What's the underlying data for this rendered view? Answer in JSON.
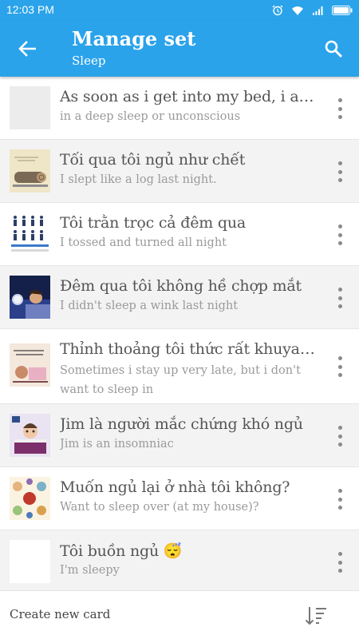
{
  "status_bar": {
    "time": "12:03 PM",
    "icons": [
      "alarm-icon",
      "wifi-icon",
      "signal-icon",
      "battery-icon"
    ]
  },
  "header": {
    "title": "Manage set",
    "subtitle": "Sleep",
    "back_icon": "arrow-back-icon",
    "search_icon": "search-icon"
  },
  "cards": [
    {
      "term": "As soon as i get into my bed, i am…",
      "definition": "in a deep sleep or unconscious",
      "image": "none"
    },
    {
      "term": "Tối qua tôi ngủ như chết",
      "definition": "I slept like a log last night.",
      "image": "sleeping-like-a-log"
    },
    {
      "term": "Tôi trằn trọc cả đêm qua",
      "definition": "I tossed and turned all night",
      "image": "sleep-positions"
    },
    {
      "term": "Đêm qua tôi không hề chợp mắt",
      "definition": "I didn't sleep a wink last night",
      "image": "awake-in-bed"
    },
    {
      "term": "Thỉnh thoảng tôi thức rất khuya n…",
      "definition": "Sometimes i stay up very late, but i don't want to sleep in",
      "image": "weekend-sleep-in"
    },
    {
      "term": "Jim là người mắc chứng khó ngủ",
      "definition": "Jim is an insomniac",
      "image": "insomniac"
    },
    {
      "term": "Muốn ngủ lại ở nhà tôi không?",
      "definition": "Want to sleep over (at my house)?",
      "image": "sleepover"
    },
    {
      "term": "Tôi buồn ngủ 😴",
      "definition": "I'm sleepy",
      "image": "none"
    }
  ],
  "bottom_bar": {
    "create_label": "Create new card",
    "sort_icon": "sort-icon"
  },
  "colors": {
    "accent": "#2aa3ea",
    "term_text": "#555555",
    "definition_text": "#9a9a9a",
    "alt_row": "#f3f3f3"
  }
}
